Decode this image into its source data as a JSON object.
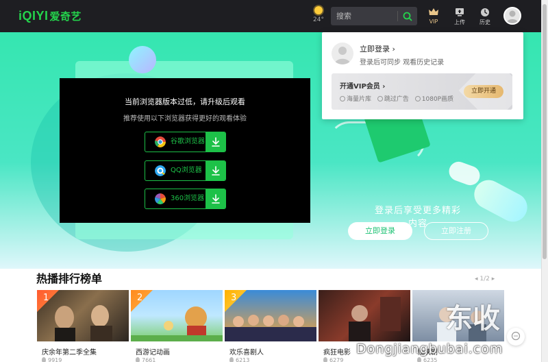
{
  "header": {
    "logo_text": "iQIYI",
    "logo_cn": "爱奇艺",
    "weather_temp": "24°",
    "search_placeholder": "搜索",
    "nav": {
      "vip_label": "VIP",
      "upload_label": "上传",
      "history_label": "历史"
    }
  },
  "banner": {
    "slogan": "登录后享受更多精彩内容",
    "primary_button": "立即登录",
    "secondary_button": "立即注册"
  },
  "modal": {
    "title": "当前浏览器版本过低，请升级后观看",
    "subtitle": "推荐使用以下浏览器获得更好的观看体验",
    "browsers": [
      {
        "label": "谷歌浏览器",
        "icon": "chrome-icon"
      },
      {
        "label": "QQ浏览器",
        "icon": "qq-browser-icon"
      },
      {
        "label": "360浏览器",
        "icon": "360-browser-icon"
      }
    ]
  },
  "account_popover": {
    "login_label": "立即登录",
    "description": "登录后可同步 观看历史记录",
    "vip_card": {
      "title": "开通VIP会员",
      "perks": [
        "海量片库",
        "跳过广告",
        "1080P画质"
      ],
      "button": "立即开通"
    }
  },
  "ranking": {
    "title": "热播排行榜单",
    "pager": "1/2",
    "items": [
      {
        "rank": "1",
        "name": "庆余年第二季全集",
        "heat": "9919"
      },
      {
        "rank": "2",
        "name": "西游记动画",
        "heat": "7661"
      },
      {
        "rank": "3",
        "name": "欢乐喜剧人",
        "heat": "6213"
      },
      {
        "rank": "",
        "name": "疯狂电影",
        "heat": "6279"
      },
      {
        "rank": "",
        "name": "仙侠剧",
        "heat": "6235"
      }
    ]
  },
  "watermark": {
    "text": "Dongjiangbubai.com",
    "seal": "东收"
  },
  "colors": {
    "brand_green": "#1dc148",
    "header_bg": "#1e1e22",
    "banner_green": "#35e6b0"
  }
}
